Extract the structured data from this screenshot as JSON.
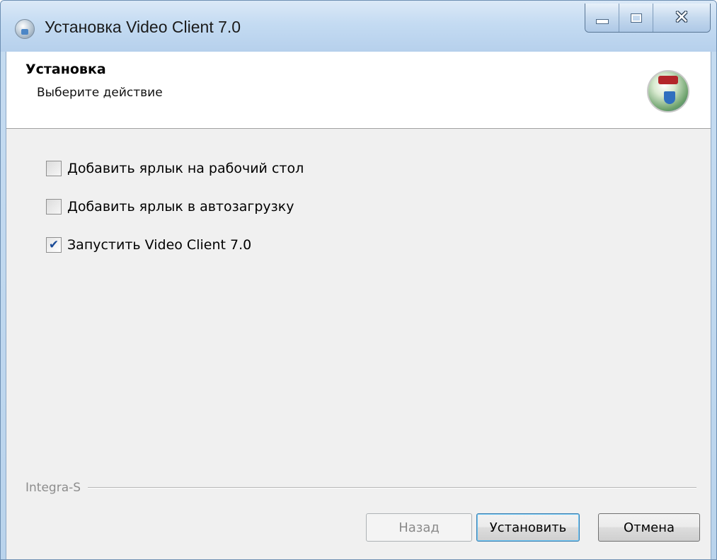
{
  "window": {
    "title": "Установка Video Client 7.0"
  },
  "header": {
    "title": "Установка",
    "subtitle": "Выберите действие"
  },
  "options": [
    {
      "label": "Добавить ярлык на рабочий стол",
      "checked": false
    },
    {
      "label": "Добавить ярлык в автозагрузку",
      "checked": false
    },
    {
      "label": "Запустить Video Client 7.0",
      "checked": true
    }
  ],
  "footer": {
    "brand": "Integra-S",
    "back_label": "Назад",
    "install_label": "Установить",
    "cancel_label": "Отмена"
  },
  "colors": {
    "checkmark": "#1b4c98",
    "default_button_border": "#3c7fb1"
  }
}
